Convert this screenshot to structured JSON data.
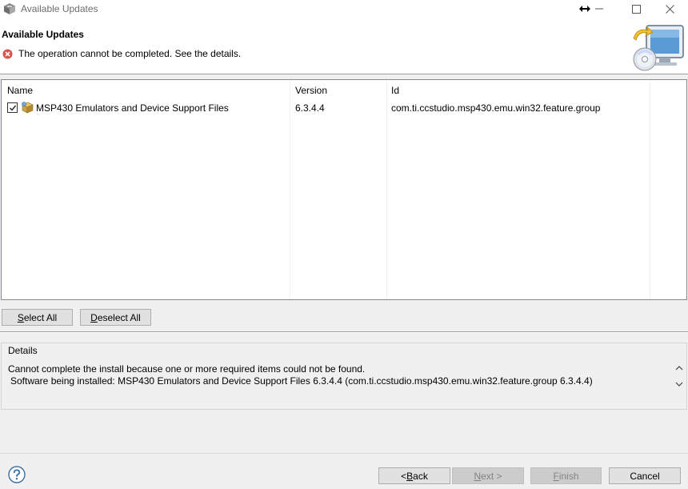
{
  "window": {
    "title": "Available Updates"
  },
  "banner": {
    "title": "Available Updates",
    "message": "The operation cannot be completed.  See the details."
  },
  "table": {
    "columns": [
      "Name",
      "Version",
      "Id"
    ],
    "rows": [
      {
        "checked": true,
        "name": "MSP430 Emulators and Device Support Files",
        "version": "6.3.4.4",
        "id": "com.ti.ccstudio.msp430.emu.win32.feature.group"
      }
    ]
  },
  "selection_buttons": {
    "select_all": {
      "pre": "",
      "key": "S",
      "post": "elect All"
    },
    "deselect_all": {
      "pre": "",
      "key": "D",
      "post": "eselect All"
    }
  },
  "details": {
    "label": "Details",
    "line1": "Cannot complete the install because one or more required items could not be found.",
    "line2": "Software being installed: MSP430 Emulators and Device Support Files 6.3.4.4 (com.ti.ccstudio.msp430.emu.win32.feature.group 6.3.4.4)"
  },
  "footer": {
    "back": {
      "pre": "< ",
      "key": "B",
      "post": "ack"
    },
    "next": {
      "pre": "",
      "key": "N",
      "post": "ext >"
    },
    "finish": {
      "pre": "",
      "key": "F",
      "post": "inish"
    },
    "cancel": "Cancel"
  },
  "colors": {
    "error_red": "#d9534f",
    "banner_bg": "#ffffff",
    "dialog_bg": "#f0f0f0"
  },
  "icons": {
    "app": "eclipse-box-icon",
    "error": "error-circle-icon",
    "banner": "install-monitor-cd-icon",
    "feature": "feature-package-icon",
    "help": "help-question-icon"
  }
}
